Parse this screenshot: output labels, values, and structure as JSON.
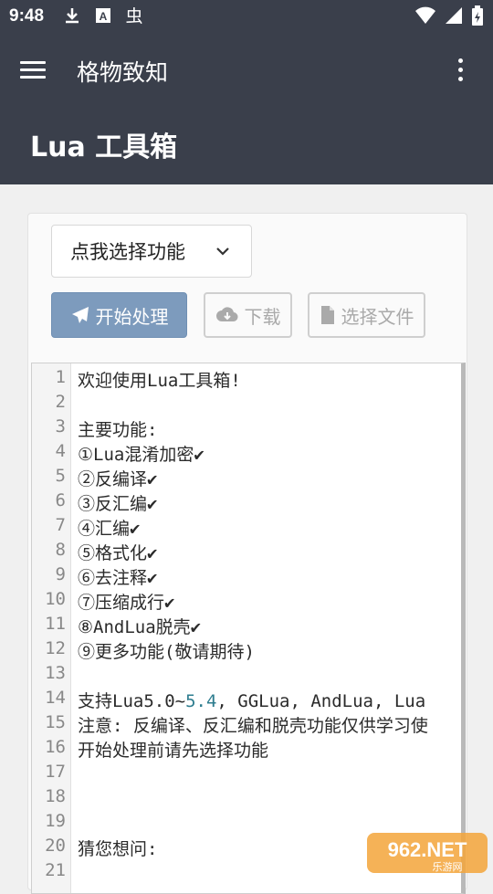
{
  "status_bar": {
    "time": "9:48",
    "left_icons": [
      "download-icon",
      "a-icon",
      "bug-icon"
    ],
    "right_icons": [
      "wifi-icon",
      "signal-icon",
      "battery-icon"
    ]
  },
  "app_bar": {
    "title": "格物致知",
    "page_title": "Lua 工具箱",
    "color": "#3a3f4b"
  },
  "toolbar": {
    "select_label": "点我选择功能",
    "start_label": "开始处理",
    "download_label": "下载",
    "choose_file_label": "选择文件",
    "accent_color": "#7d9bbd"
  },
  "editor": {
    "lines": [
      {
        "n": "1",
        "text": "欢迎使用Lua工具箱!"
      },
      {
        "n": "2",
        "text": ""
      },
      {
        "n": "3",
        "text": "主要功能:"
      },
      {
        "n": "4",
        "text": "①Lua混淆加密✔"
      },
      {
        "n": "5",
        "text": "②反编译✔"
      },
      {
        "n": "6",
        "text": "③反汇编✔"
      },
      {
        "n": "7",
        "text": "④汇编✔"
      },
      {
        "n": "8",
        "text": "⑤格式化✔"
      },
      {
        "n": "9",
        "text": "⑥去注释✔"
      },
      {
        "n": "10",
        "text": "⑦压缩成行✔"
      },
      {
        "n": "11",
        "text": "⑧AndLua脱壳✔"
      },
      {
        "n": "12",
        "text": "⑨更多功能(敬请期待)"
      },
      {
        "n": "13",
        "text": ""
      },
      {
        "n": "14",
        "text": "支持Lua5.0~",
        "highlight": "5.4",
        "after": ", GGLua, AndLua, Lua"
      },
      {
        "n": "15",
        "text": "注意: 反编译、反汇编和脱壳功能仅供学习使"
      },
      {
        "n": "16",
        "text": "开始处理前请先选择功能"
      },
      {
        "n": "17",
        "text": ""
      },
      {
        "n": "18",
        "text": ""
      },
      {
        "n": "19",
        "text": ""
      },
      {
        "n": "20",
        "text": "猜您想问:"
      },
      {
        "n": "21",
        "text": ""
      }
    ]
  },
  "watermark": {
    "brand": "962.NET",
    "sub": "乐游网"
  }
}
